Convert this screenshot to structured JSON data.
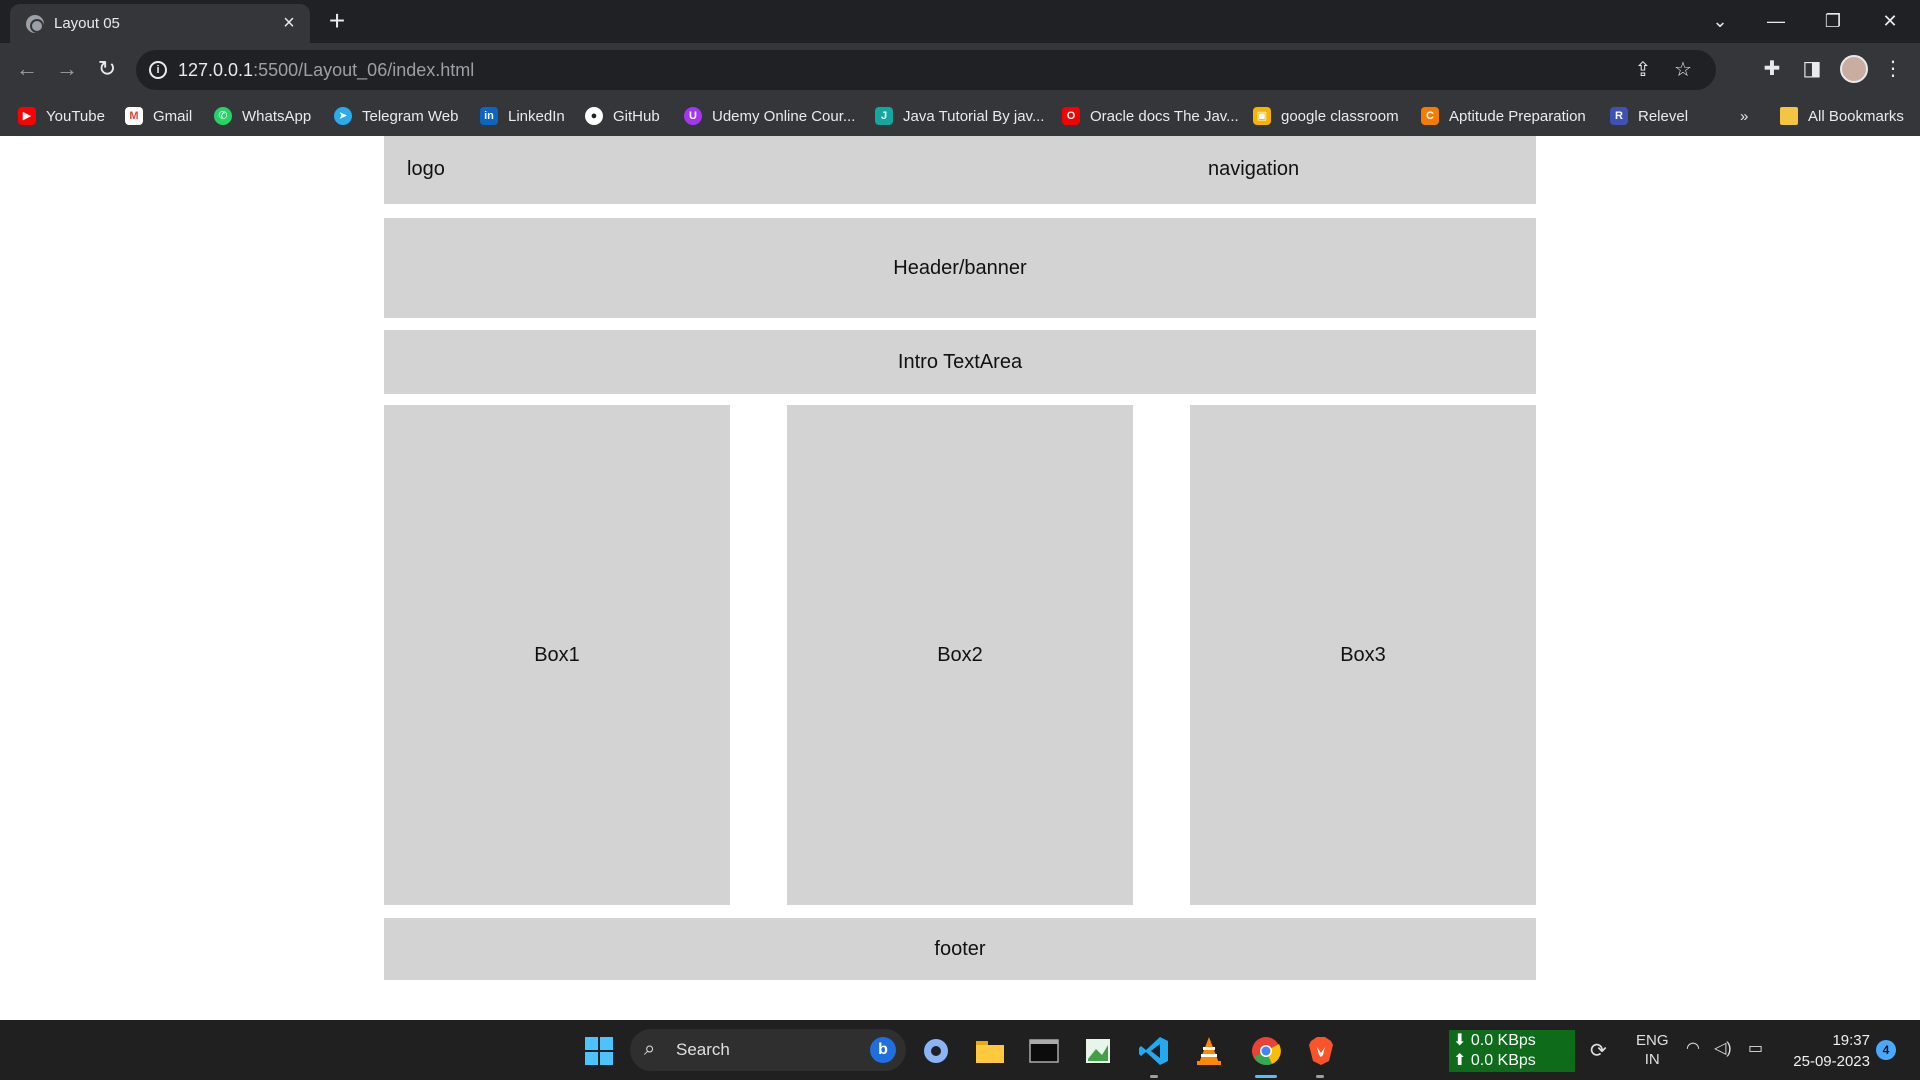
{
  "browser": {
    "tab": {
      "title": "Layout 05",
      "close_glyph": "×"
    },
    "new_tab_glyph": "+",
    "window_controls": {
      "dropdown": "⌄",
      "minimize": "—",
      "restore": "❐",
      "close": "✕"
    },
    "url": {
      "host": "127.0.0.1",
      "rest": ":5500/Layout_06/index.html"
    },
    "bookmarks": [
      {
        "label": "YouTube",
        "icon": "youtube-icon",
        "color": "#ff0000"
      },
      {
        "label": "Gmail",
        "icon": "gmail-icon",
        "color": "#ea4335"
      },
      {
        "label": "WhatsApp",
        "icon": "whatsapp-icon",
        "color": "#25d366"
      },
      {
        "label": "Telegram Web",
        "icon": "telegram-icon",
        "color": "#2aabee"
      },
      {
        "label": "LinkedIn",
        "icon": "linkedin-icon",
        "color": "#0a66c2"
      },
      {
        "label": "GitHub",
        "icon": "github-icon",
        "color": "#ffffff"
      },
      {
        "label": "Udemy Online Cour...",
        "icon": "udemy-icon",
        "color": "#a435f0"
      },
      {
        "label": "Java Tutorial By jav...",
        "icon": "javatpoint-icon",
        "color": "#13a89e"
      },
      {
        "label": "Oracle docs The Jav...",
        "icon": "oracle-icon",
        "color": "#f80000"
      },
      {
        "label": "google classroom",
        "icon": "classroom-icon",
        "color": "#f4b400"
      },
      {
        "label": "Aptitude Preparation",
        "icon": "aptitude-icon",
        "color": "#f57c00"
      },
      {
        "label": "Relevel",
        "icon": "relevel-icon",
        "color": "#3f51b5"
      }
    ],
    "bookmarks_overflow": "»",
    "all_bookmarks": "All Bookmarks"
  },
  "page": {
    "logo": "logo",
    "navigation": "navigation",
    "header_banner": "Header/banner",
    "intro": "Intro TextArea",
    "boxes": [
      "Box1",
      "Box2",
      "Box3"
    ],
    "footer": "footer"
  },
  "taskbar": {
    "search_label": "Search",
    "network": {
      "down": "0.0 KBps",
      "up": "0.0 KBps"
    },
    "language": {
      "line1": "ENG",
      "line2": "IN"
    },
    "time": "19:37",
    "date": "25-09-2023",
    "notification_count": "4"
  }
}
